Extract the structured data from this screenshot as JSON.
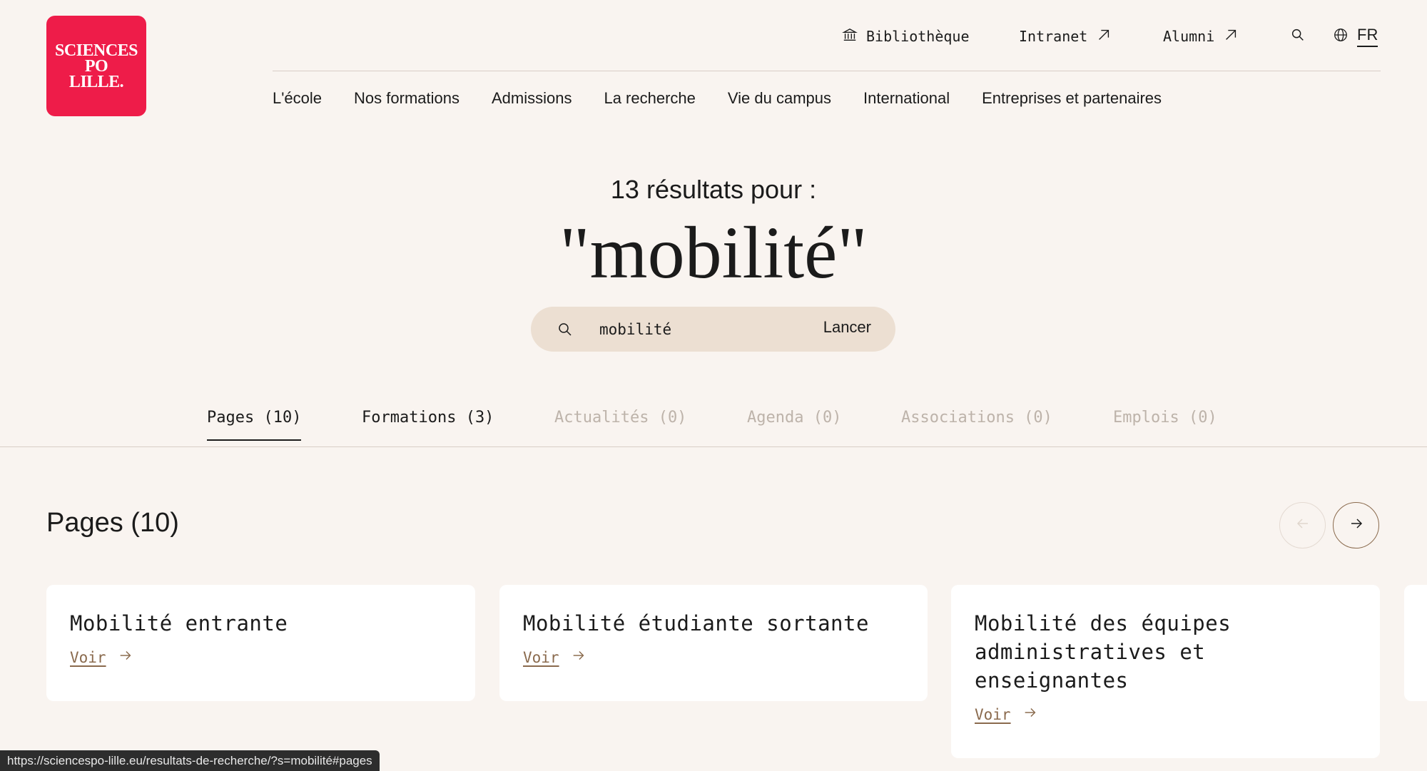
{
  "logo": {
    "lines": [
      "SCIENCES",
      "PO",
      "LILLE."
    ]
  },
  "utility_nav": {
    "library": "Bibliothèque",
    "intranet": "Intranet",
    "alumni": "Alumni",
    "language": "FR"
  },
  "main_nav": [
    "L'école",
    "Nos formations",
    "Admissions",
    "La recherche",
    "Vie du campus",
    "International",
    "Entreprises et partenaires"
  ],
  "hero": {
    "result_count": "13 résultats pour :",
    "query": "\"mobilité\""
  },
  "search": {
    "value": "mobilité",
    "button": "Lancer"
  },
  "tabs": [
    {
      "label": "Pages (10)",
      "state": "active"
    },
    {
      "label": "Formations (3)",
      "state": "enabled"
    },
    {
      "label": "Actualités (0)",
      "state": "disabled"
    },
    {
      "label": "Agenda (0)",
      "state": "disabled"
    },
    {
      "label": "Associations (0)",
      "state": "disabled"
    },
    {
      "label": "Emplois (0)",
      "state": "disabled"
    }
  ],
  "section": {
    "title": "Pages (10)"
  },
  "cards": [
    {
      "title": "Mobilité entrante",
      "link": "Voir"
    },
    {
      "title": "Mobilité étudiante sortante",
      "link": "Voir"
    },
    {
      "title": "Mobilité des équipes administratives et enseignantes",
      "link": "Voir"
    }
  ],
  "status_bar": {
    "url": "https://sciencespo-lille.eu/resultats-de-recherche/?s=mobilité#pages"
  },
  "colors": {
    "background": "#f9f4f0",
    "brand": "#ee1c49",
    "search_bg": "#ecdfd2",
    "accent": "#8a6a4d",
    "disabled_text": "#bdb3aa"
  },
  "icons": [
    "library-icon",
    "external-arrow-icon",
    "search-icon",
    "globe-icon",
    "arrow-left-icon",
    "arrow-right-icon"
  ]
}
